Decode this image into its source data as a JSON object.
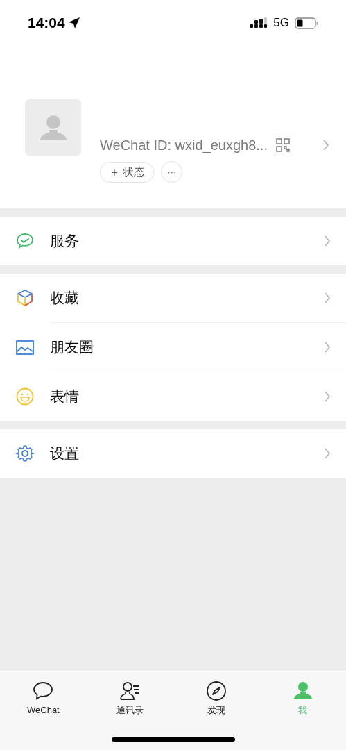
{
  "status_bar": {
    "time": "14:04",
    "network": "5G"
  },
  "profile": {
    "wechat_id": "WeChat ID: wxid_euxgh8...",
    "status_button": "＋ 状态",
    "more_button": "···"
  },
  "menu_groups": [
    {
      "items": [
        {
          "kind": "service",
          "label": "服务"
        }
      ]
    },
    {
      "items": [
        {
          "kind": "favorites",
          "label": "收藏"
        },
        {
          "kind": "moments",
          "label": "朋友圈"
        },
        {
          "kind": "stickers",
          "label": "表情"
        }
      ]
    },
    {
      "items": [
        {
          "kind": "settings",
          "label": "设置"
        }
      ]
    }
  ],
  "tab_bar": [
    {
      "kind": "chats",
      "label": "WeChat",
      "selected": false
    },
    {
      "kind": "contacts",
      "label": "通讯录",
      "selected": false
    },
    {
      "kind": "discover",
      "label": "发现",
      "selected": false
    },
    {
      "kind": "me",
      "label": "我",
      "selected": true
    }
  ]
}
